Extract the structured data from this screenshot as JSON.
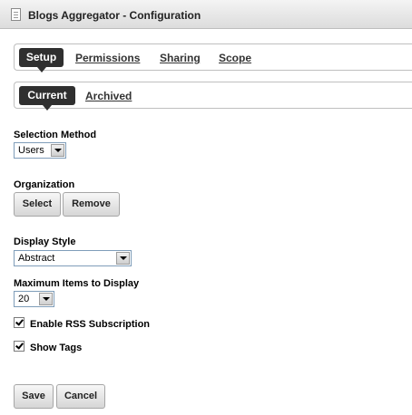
{
  "window": {
    "title": "Blogs Aggregator - Configuration"
  },
  "main_tabs": {
    "active": "Setup",
    "links": [
      "Permissions",
      "Sharing",
      "Scope"
    ]
  },
  "sub_tabs": {
    "active": "Current",
    "links": [
      "Archived"
    ]
  },
  "selection_method": {
    "label": "Selection Method",
    "value": "Users"
  },
  "organization": {
    "label": "Organization",
    "select_label": "Select",
    "remove_label": "Remove"
  },
  "display_style": {
    "label": "Display Style",
    "value": "Abstract"
  },
  "max_items": {
    "label": "Maximum Items to Display",
    "value": "20"
  },
  "rss": {
    "label": "Enable RSS Subscription",
    "checked": true
  },
  "show_tags": {
    "label": "Show Tags",
    "checked": true
  },
  "footer": {
    "save_label": "Save",
    "cancel_label": "Cancel"
  }
}
